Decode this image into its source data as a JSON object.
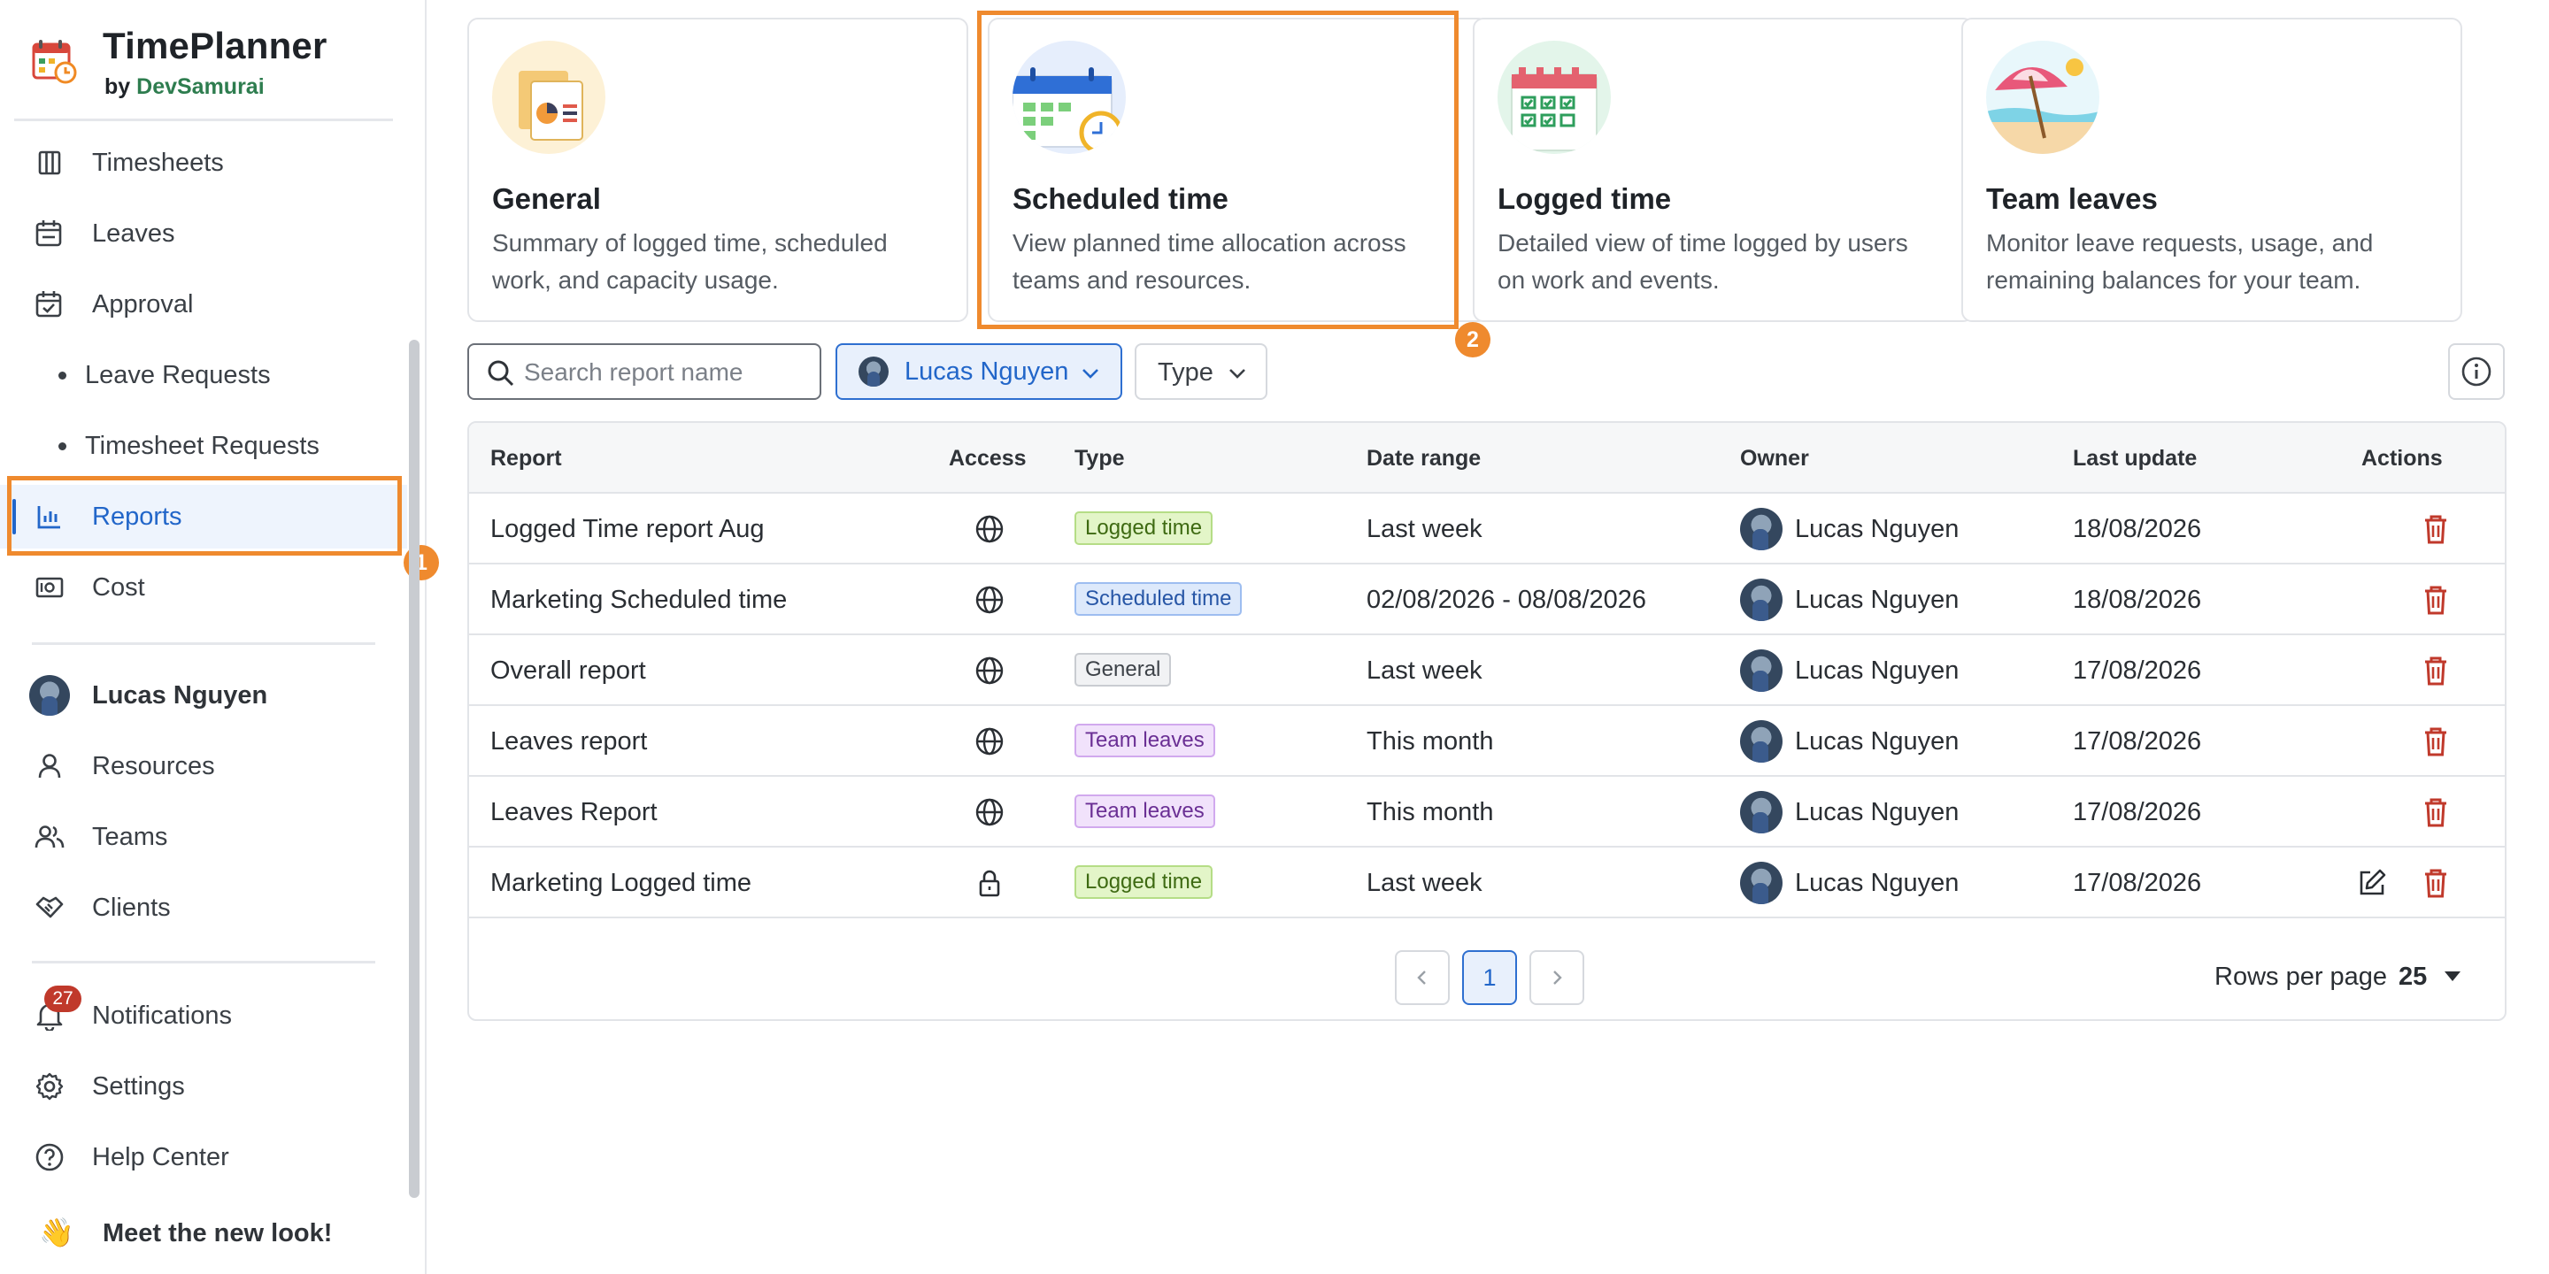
{
  "app": {
    "title": "TimePlanner",
    "by_prefix": "by",
    "company": "DevSamurai"
  },
  "sidebar": {
    "items": [
      {
        "label": "Timesheets"
      },
      {
        "label": "Leaves"
      },
      {
        "label": "Approval"
      },
      {
        "label": "Leave Requests"
      },
      {
        "label": "Timesheet Requests"
      },
      {
        "label": "Reports"
      },
      {
        "label": "Cost"
      }
    ],
    "user": {
      "name": "Lucas Nguyen"
    },
    "admin_items": [
      {
        "label": "Resources"
      },
      {
        "label": "Teams"
      },
      {
        "label": "Clients"
      }
    ],
    "bottom_items": [
      {
        "label": "Notifications",
        "badge": "27"
      },
      {
        "label": "Settings"
      },
      {
        "label": "Help Center"
      }
    ],
    "meet": {
      "emoji": "👋",
      "label": "Meet the new look!"
    }
  },
  "annotations": {
    "marker_1": "1",
    "marker_2": "2",
    "color": "#ef8a2e"
  },
  "cards": [
    {
      "title": "General",
      "desc": "Summary of logged time, scheduled work, and capacity usage."
    },
    {
      "title": "Scheduled time",
      "desc": "View planned time allocation across teams and resources."
    },
    {
      "title": "Logged time",
      "desc": "Detailed view of time logged by users on work and events."
    },
    {
      "title": "Team leaves",
      "desc": "Monitor leave requests, usage, and remaining balances for your team."
    }
  ],
  "filters": {
    "search_placeholder": "Search report name",
    "owner": "Lucas Nguyen",
    "type": "Type"
  },
  "table": {
    "headers": {
      "report": "Report",
      "access": "Access",
      "type": "Type",
      "date_range": "Date range",
      "owner": "Owner",
      "last_update": "Last update",
      "actions": "Actions"
    },
    "rows": [
      {
        "report": "Logged Time report Aug",
        "access": "public",
        "type": "Logged time",
        "date_range": "Last week",
        "owner": "Lucas Nguyen",
        "last_update": "18/08/2026"
      },
      {
        "report": "Marketing Scheduled time",
        "access": "public",
        "type": "Scheduled time",
        "date_range": "02/08/2026 - 08/08/2026",
        "owner": "Lucas Nguyen",
        "last_update": "18/08/2026"
      },
      {
        "report": "Overall report",
        "access": "public",
        "type": "General",
        "date_range": "Last week",
        "owner": "Lucas Nguyen",
        "last_update": "17/08/2026"
      },
      {
        "report": "Leaves report",
        "access": "public",
        "type": "Team leaves",
        "date_range": "This month",
        "owner": "Lucas Nguyen",
        "last_update": "17/08/2026"
      },
      {
        "report": "Leaves Report",
        "access": "public",
        "type": "Team leaves",
        "date_range": "This month",
        "owner": "Lucas Nguyen",
        "last_update": "17/08/2026"
      },
      {
        "report": "Marketing Logged time",
        "access": "private",
        "type": "Logged time",
        "date_range": "Last week",
        "owner": "Lucas Nguyen",
        "last_update": "17/08/2026"
      }
    ]
  },
  "pagination": {
    "current_page": "1",
    "rows_per_page_label": "Rows per page",
    "rows_per_page": "25"
  },
  "colors": {
    "accent": "#2266c9",
    "delete": "#c0392b",
    "highlight": "#ef8a2e"
  }
}
